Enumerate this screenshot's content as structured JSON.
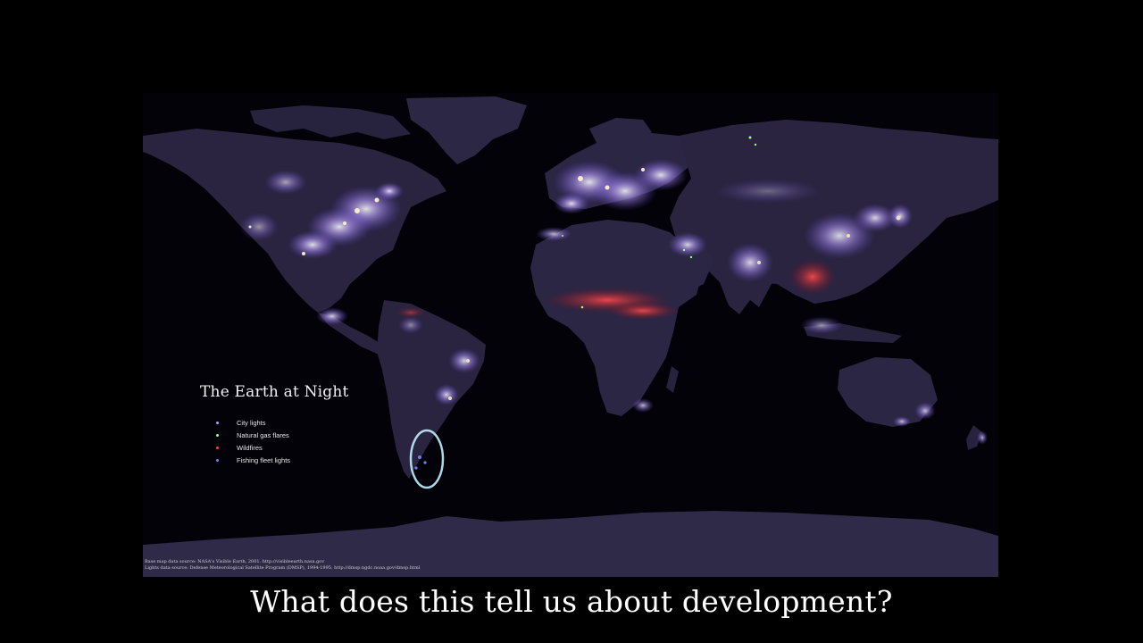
{
  "map": {
    "title": "The Earth at Night",
    "legend": [
      {
        "label": "City lights",
        "color": "#b79cff"
      },
      {
        "label": "Natural gas flares",
        "color": "#9dff7a"
      },
      {
        "label": "Wildfires",
        "color": "#ff3b3b"
      },
      {
        "label": "Fishing fleet lights",
        "color": "#6f7dff"
      }
    ],
    "credits": [
      "Base map data source: NASA's Visible Earth, 2001. http://visibleearth.nasa.gov",
      "Lights data source: Defense Meteorological Satellite Program (DMSP), 1994-1995. http://dmsp.ngdc.noaa.gov/dmsp.html"
    ]
  },
  "caption": "What does this tell us about development?",
  "colors": {
    "background": "#000000",
    "land": "#2a2440",
    "ocean": "#020208",
    "city_lights": "#c8b4ff",
    "wildfires": "#ff3b3b",
    "gas_flares": "#9dff7a",
    "highlight_circle": "#bfeeff"
  }
}
